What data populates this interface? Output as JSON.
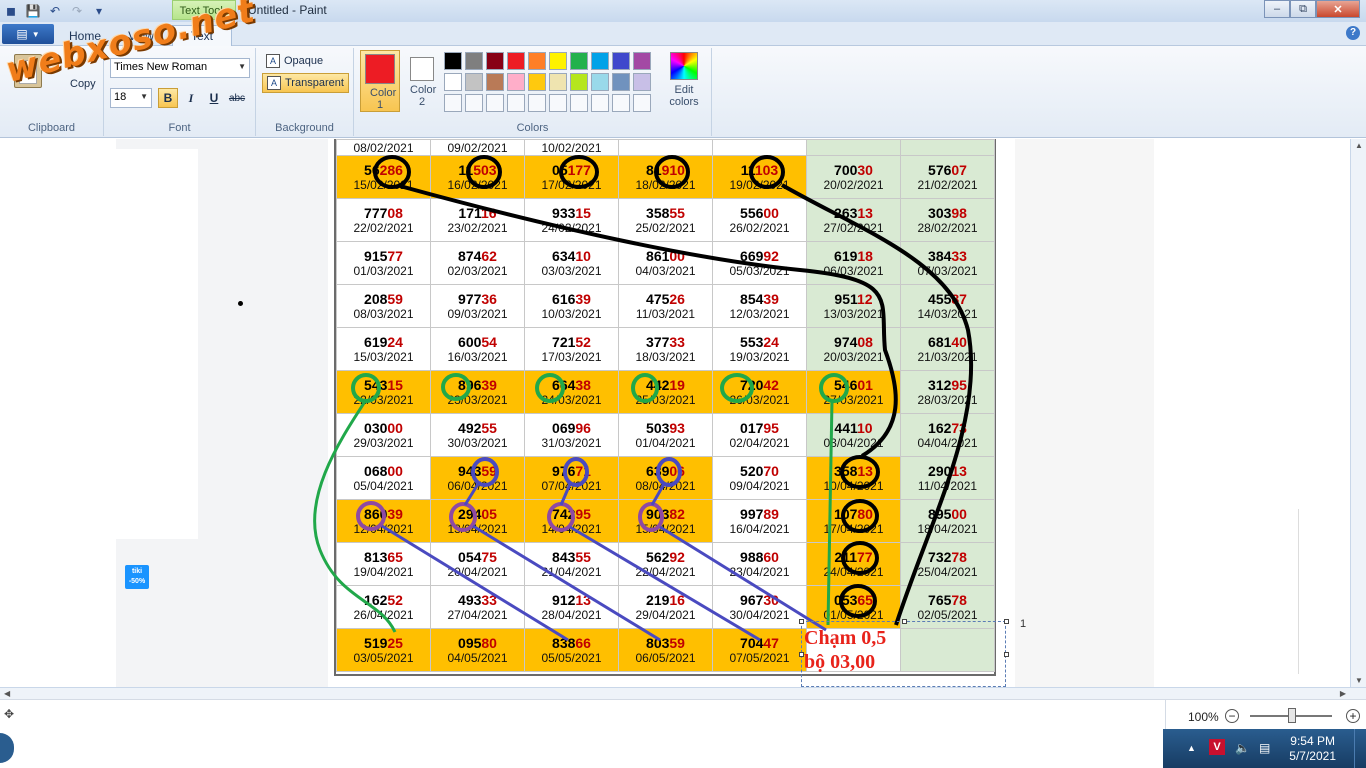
{
  "window": {
    "title": "Untitled - Paint",
    "context_tab": "Text Tools"
  },
  "tabs": {
    "file": "",
    "home": "Home",
    "view": "View",
    "text": "Text"
  },
  "ribbon": {
    "clipboard": {
      "label": "Clipboard",
      "copy": "Copy"
    },
    "font": {
      "label": "Font",
      "family": "Times New Roman",
      "size": "18",
      "bold": "B",
      "italic": "I",
      "underline": "U",
      "strike": "abc"
    },
    "background": {
      "label": "Background",
      "opaque": "Opaque",
      "transparent": "Transparent"
    },
    "colors": {
      "label": "Colors",
      "color1_label": "Color 1",
      "color2_label": "Color 2",
      "color1": "#ed1c24",
      "color2": "#ffffff",
      "edit": "Edit colors",
      "palette": [
        "#000000",
        "#7f7f7f",
        "#880015",
        "#ed1c24",
        "#ff7f27",
        "#fff200",
        "#22b14c",
        "#00a2e8",
        "#3f48cc",
        "#a349a4",
        "#ffffff",
        "#c3c3c3",
        "#b97a57",
        "#ffaec9",
        "#ffc90e",
        "#efe4b0",
        "#b5e61d",
        "#99d9ea",
        "#7092be",
        "#c8bfe7"
      ]
    }
  },
  "watermark": "webxoso.net",
  "tiki": {
    "name": "tiki",
    "discount": "-50%"
  },
  "table": {
    "top_dates": [
      "08/02/2021",
      "09/02/2021",
      "10/02/2021",
      "",
      "",
      "",
      ""
    ],
    "rows": [
      {
        "cells": [
          {
            "n": "56",
            "t": "286",
            "d": "15/02/2021",
            "c": "o"
          },
          {
            "n": "11",
            "t": "503",
            "d": "16/02/2021",
            "c": "o"
          },
          {
            "n": "05",
            "t": "177",
            "d": "17/02/2021",
            "c": "o"
          },
          {
            "n": "81",
            "t": "910",
            "d": "18/02/2021",
            "c": "o"
          },
          {
            "n": "11",
            "t": "103",
            "d": "19/02/2021",
            "c": "o"
          },
          {
            "n": "700",
            "t": "30",
            "d": "20/02/2021",
            "c": "g"
          },
          {
            "n": "576",
            "t": "07",
            "d": "21/02/2021",
            "c": "g"
          }
        ]
      },
      {
        "cells": [
          {
            "n": "777",
            "t": "08",
            "d": "22/02/2021",
            "c": ""
          },
          {
            "n": "171",
            "t": "16",
            "d": "23/02/2021",
            "c": ""
          },
          {
            "n": "933",
            "t": "15",
            "d": "24/02/2021",
            "c": ""
          },
          {
            "n": "358",
            "t": "55",
            "d": "25/02/2021",
            "c": ""
          },
          {
            "n": "556",
            "t": "00",
            "d": "26/02/2021",
            "c": ""
          },
          {
            "n": "263",
            "t": "13",
            "d": "27/02/2021",
            "c": "g"
          },
          {
            "n": "303",
            "t": "98",
            "d": "28/02/2021",
            "c": "g"
          }
        ]
      },
      {
        "cells": [
          {
            "n": "915",
            "t": "77",
            "d": "01/03/2021",
            "c": ""
          },
          {
            "n": "874",
            "t": "62",
            "d": "02/03/2021",
            "c": ""
          },
          {
            "n": "634",
            "t": "10",
            "d": "03/03/2021",
            "c": ""
          },
          {
            "n": "861",
            "t": "00",
            "d": "04/03/2021",
            "c": ""
          },
          {
            "n": "669",
            "t": "92",
            "d": "05/03/2021",
            "c": ""
          },
          {
            "n": "619",
            "t": "18",
            "d": "06/03/2021",
            "c": "g"
          },
          {
            "n": "384",
            "t": "33",
            "d": "07/03/2021",
            "c": "g"
          }
        ]
      },
      {
        "cells": [
          {
            "n": "208",
            "t": "59",
            "d": "08/03/2021",
            "c": ""
          },
          {
            "n": "977",
            "t": "36",
            "d": "09/03/2021",
            "c": ""
          },
          {
            "n": "616",
            "t": "39",
            "d": "10/03/2021",
            "c": ""
          },
          {
            "n": "475",
            "t": "26",
            "d": "11/03/2021",
            "c": ""
          },
          {
            "n": "854",
            "t": "39",
            "d": "12/03/2021",
            "c": ""
          },
          {
            "n": "951",
            "t": "12",
            "d": "13/03/2021",
            "c": "g"
          },
          {
            "n": "455",
            "t": "87",
            "d": "14/03/2021",
            "c": "g"
          }
        ]
      },
      {
        "cells": [
          {
            "n": "619",
            "t": "24",
            "d": "15/03/2021",
            "c": ""
          },
          {
            "n": "600",
            "t": "54",
            "d": "16/03/2021",
            "c": ""
          },
          {
            "n": "721",
            "t": "52",
            "d": "17/03/2021",
            "c": ""
          },
          {
            "n": "377",
            "t": "33",
            "d": "18/03/2021",
            "c": ""
          },
          {
            "n": "553",
            "t": "24",
            "d": "19/03/2021",
            "c": ""
          },
          {
            "n": "974",
            "t": "08",
            "d": "20/03/2021",
            "c": "g"
          },
          {
            "n": "681",
            "t": "40",
            "d": "21/03/2021",
            "c": "g"
          }
        ]
      },
      {
        "cells": [
          {
            "n": "543",
            "t": "15",
            "d": "22/03/2021",
            "c": "o"
          },
          {
            "n": "896",
            "t": "39",
            "d": "23/03/2021",
            "c": "o"
          },
          {
            "n": "664",
            "t": "38",
            "d": "24/03/2021",
            "c": "o"
          },
          {
            "n": "442",
            "t": "19",
            "d": "25/03/2021",
            "c": "o"
          },
          {
            "n": "720",
            "t": "42",
            "d": "26/03/2021",
            "c": "o"
          },
          {
            "n": "546",
            "t": "01",
            "d": "27/03/2021",
            "c": "o"
          },
          {
            "n": "312",
            "t": "95",
            "d": "28/03/2021",
            "c": "g"
          }
        ]
      },
      {
        "cells": [
          {
            "n": "030",
            "t": "00",
            "d": "29/03/2021",
            "c": ""
          },
          {
            "n": "492",
            "t": "55",
            "d": "30/03/2021",
            "c": ""
          },
          {
            "n": "069",
            "t": "96",
            "d": "31/03/2021",
            "c": ""
          },
          {
            "n": "503",
            "t": "93",
            "d": "01/04/2021",
            "c": ""
          },
          {
            "n": "017",
            "t": "95",
            "d": "02/04/2021",
            "c": ""
          },
          {
            "n": "441",
            "t": "10",
            "d": "03/04/2021",
            "c": "g"
          },
          {
            "n": "162",
            "t": "73",
            "d": "04/04/2021",
            "c": "g"
          }
        ]
      },
      {
        "cells": [
          {
            "n": "068",
            "t": "00",
            "d": "05/04/2021",
            "c": ""
          },
          {
            "n": "943",
            "t": "59",
            "d": "06/04/2021",
            "c": "o"
          },
          {
            "n": "976",
            "t": "71",
            "d": "07/04/2021",
            "c": "o"
          },
          {
            "n": "639",
            "t": "06",
            "d": "08/04/2021",
            "c": "o"
          },
          {
            "n": "520",
            "t": "70",
            "d": "09/04/2021",
            "c": ""
          },
          {
            "n": "358",
            "t": "13",
            "d": "10/04/2021",
            "c": "o"
          },
          {
            "n": "290",
            "t": "13",
            "d": "11/04/2021",
            "c": "g"
          }
        ]
      },
      {
        "cells": [
          {
            "n": "860",
            "t": "39",
            "d": "12/04/2021",
            "c": "o"
          },
          {
            "n": "294",
            "t": "05",
            "d": "13/04/2021",
            "c": "o"
          },
          {
            "n": "742",
            "t": "95",
            "d": "14/04/2021",
            "c": "o"
          },
          {
            "n": "903",
            "t": "82",
            "d": "15/04/2021",
            "c": "o"
          },
          {
            "n": "997",
            "t": "89",
            "d": "16/04/2021",
            "c": ""
          },
          {
            "n": "107",
            "t": "80",
            "d": "17/04/2021",
            "c": "o"
          },
          {
            "n": "895",
            "t": "00",
            "d": "18/04/2021",
            "c": "g"
          }
        ]
      },
      {
        "cells": [
          {
            "n": "813",
            "t": "65",
            "d": "19/04/2021",
            "c": ""
          },
          {
            "n": "054",
            "t": "75",
            "d": "20/04/2021",
            "c": ""
          },
          {
            "n": "843",
            "t": "55",
            "d": "21/04/2021",
            "c": ""
          },
          {
            "n": "562",
            "t": "92",
            "d": "22/04/2021",
            "c": ""
          },
          {
            "n": "988",
            "t": "60",
            "d": "23/04/2021",
            "c": ""
          },
          {
            "n": "211",
            "t": "77",
            "d": "24/04/2021",
            "c": "o"
          },
          {
            "n": "732",
            "t": "78",
            "d": "25/04/2021",
            "c": "g"
          }
        ]
      },
      {
        "cells": [
          {
            "n": "162",
            "t": "52",
            "d": "26/04/2021",
            "c": ""
          },
          {
            "n": "493",
            "t": "33",
            "d": "27/04/2021",
            "c": ""
          },
          {
            "n": "912",
            "t": "13",
            "d": "28/04/2021",
            "c": ""
          },
          {
            "n": "219",
            "t": "16",
            "d": "29/04/2021",
            "c": ""
          },
          {
            "n": "967",
            "t": "30",
            "d": "30/04/2021",
            "c": ""
          },
          {
            "n": "053",
            "t": "65",
            "d": "01/05/2021",
            "c": "o"
          },
          {
            "n": "765",
            "t": "78",
            "d": "02/05/2021",
            "c": "g"
          }
        ]
      },
      {
        "cells": [
          {
            "n": "519",
            "t": "25",
            "d": "03/05/2021",
            "c": "o"
          },
          {
            "n": "095",
            "t": "80",
            "d": "04/05/2021",
            "c": "o"
          },
          {
            "n": "838",
            "t": "66",
            "d": "05/05/2021",
            "c": "o"
          },
          {
            "n": "803",
            "t": "59",
            "d": "06/05/2021",
            "c": "o"
          },
          {
            "n": "704",
            "t": "47",
            "d": "07/05/2021",
            "c": "o"
          },
          {
            "n": "",
            "t": "",
            "d": "",
            "c": ""
          },
          {
            "n": "",
            "t": "",
            "d": "",
            "c": "g"
          }
        ]
      }
    ]
  },
  "annotation_text": {
    "line1": "Chạm 0,5",
    "line2": "bộ 03,00"
  },
  "side_number": "1",
  "status": {
    "zoom": "100%"
  },
  "taskbar": {
    "time": "9:54 PM",
    "date": "5/7/2021",
    "v_icon": "V"
  }
}
